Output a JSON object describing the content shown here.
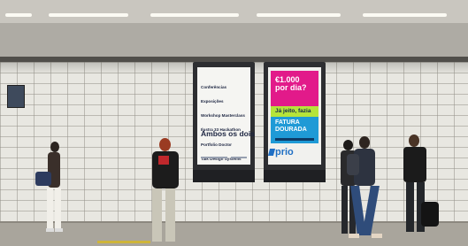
{
  "scene": {
    "description_colors": {
      "wall_tile": "#e8e7e1",
      "kiosk_frame": "#2d2e31",
      "magenta": "#e21a8a",
      "lime": "#b6e43a",
      "blue": "#1f9ad6"
    }
  },
  "ad_left": {
    "events": [
      "Conferências",
      "Exposições",
      "Workshop Masterclass",
      "Ilustra 33 Hackathon",
      "Portfolio Doctor",
      "Talk Design Systems",
      "Gala Prémios"
    ],
    "headline": "Ambos os dois"
  },
  "ad_right": {
    "headline_line1": "€1.000",
    "headline_line2": "por dia?",
    "tagline": "Já jeito, fazia",
    "offer_line1": "FATURA",
    "offer_line2": "DOURADA",
    "brand": "prio"
  }
}
